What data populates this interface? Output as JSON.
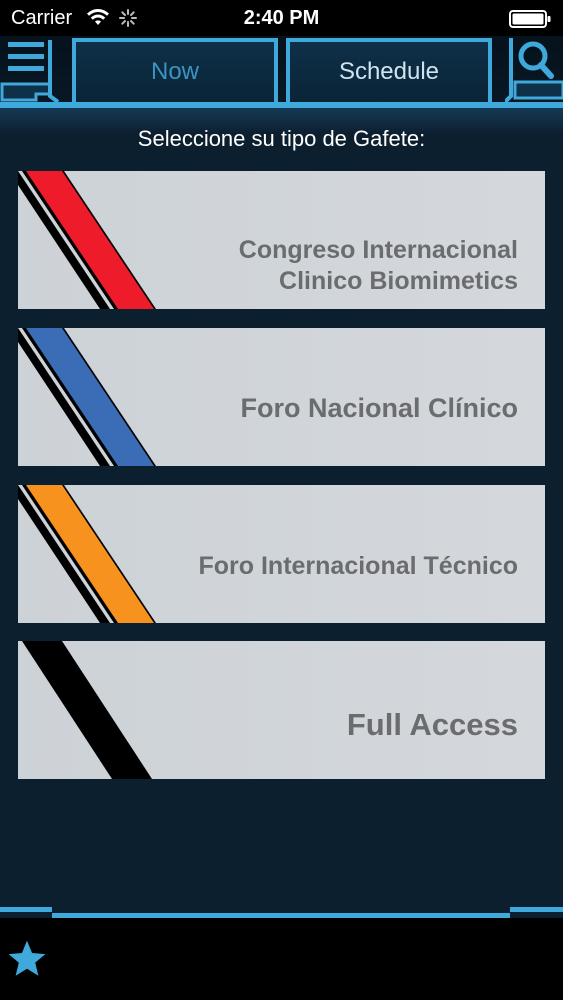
{
  "status_bar": {
    "carrier": "Carrier",
    "time": "2:40 PM"
  },
  "header": {
    "menu_icon": "hamburger-menu-icon",
    "search_icon": "search-icon",
    "tabs": [
      {
        "label": "Now"
      },
      {
        "label": "Schedule"
      }
    ]
  },
  "prompt": "Seleccione su tipo de Gafete:",
  "badges": [
    {
      "label": "Congreso Internacional\nClinico Biomimetics",
      "stripe_color": "#ee1c2b"
    },
    {
      "label": "Foro Nacional Clínico",
      "stripe_color": "#3b6cb6"
    },
    {
      "label": "Foro Internacional Técnico",
      "stripe_color": "#f7921e"
    },
    {
      "label": "Full Access",
      "stripe_color": "#000000"
    }
  ],
  "tab_bar": {
    "favorites_icon": "star-icon"
  },
  "colors": {
    "accent": "#3fa9dc",
    "background": "#0c1f2f",
    "star": "#3fa9dc"
  }
}
